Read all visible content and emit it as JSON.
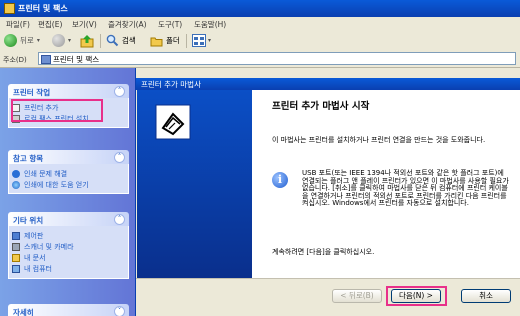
{
  "window": {
    "title": "프린터 및 팩스"
  },
  "menu": {
    "file": "파일(F)",
    "edit": "편집(E)",
    "view": "보기(V)",
    "favorites": "즐겨찾기(A)",
    "tools": "도구(T)",
    "help": "도움말(H)"
  },
  "toolbar": {
    "back_label": "뒤로",
    "search_label": "검색",
    "folders_label": "폴더"
  },
  "address": {
    "label": "주소(D)",
    "value": "프린터 및 팩스"
  },
  "left_pane": {
    "printer_tasks": {
      "title": "프린터 작업",
      "items": [
        {
          "label": "프린터 추가",
          "icon": "add-printer-icon"
        },
        {
          "label": "로컬 팩스 프린터 설치",
          "icon": "fax-icon"
        }
      ]
    },
    "see_also": {
      "title": "참고 항목",
      "items": [
        {
          "label": "인쇄 문제 해결",
          "icon": "help-icon"
        },
        {
          "label": "인쇄에 대한 도움 얻기",
          "icon": "globe-icon"
        }
      ]
    },
    "other_places": {
      "title": "기타 위치",
      "items": [
        {
          "label": "제어판",
          "icon": "control-panel-icon"
        },
        {
          "label": "스캐너 및 카메라",
          "icon": "scanner-icon"
        },
        {
          "label": "내 문서",
          "icon": "folder-icon"
        },
        {
          "label": "내 컴퓨터",
          "icon": "computer-icon"
        }
      ]
    },
    "details": {
      "title": "자세히"
    }
  },
  "wizard": {
    "title": "프린터 추가 마법사",
    "heading": "프린터 추가 마법사 시작",
    "intro": "이 마법사는 프린터를 설치하거나 프린터 연결을 만드는 것을 도와줍니다.",
    "usb_note": "USB 포트(또는 IEEE 1394나 적외선 포트와 같은 핫 플러그 포트)에 연결되는 플러그 앤 플레이 프린터가 있으면 이 마법사를 사용할 필요가 없습니다. [취소]를 클릭하여 마법사를 닫은 뒤 컴퓨터에 프린터 케이블을 연결하거나 프린터의 적외선 포트로 프린터를 가리킨 다음 프린터를 켜십시오. Windows에서 프린터를 자동으로 설치합니다.",
    "continue": "계속하려면 [다음]을 클릭하십시오.",
    "buttons": {
      "back": "< 뒤로(B)",
      "next": "다음(N) >",
      "cancel": "취소"
    }
  },
  "colors": {
    "highlight": "#e8308a",
    "title_blue": "#0a3fb0",
    "task_pane": "#6d8ee0",
    "link": "#215dc6"
  }
}
